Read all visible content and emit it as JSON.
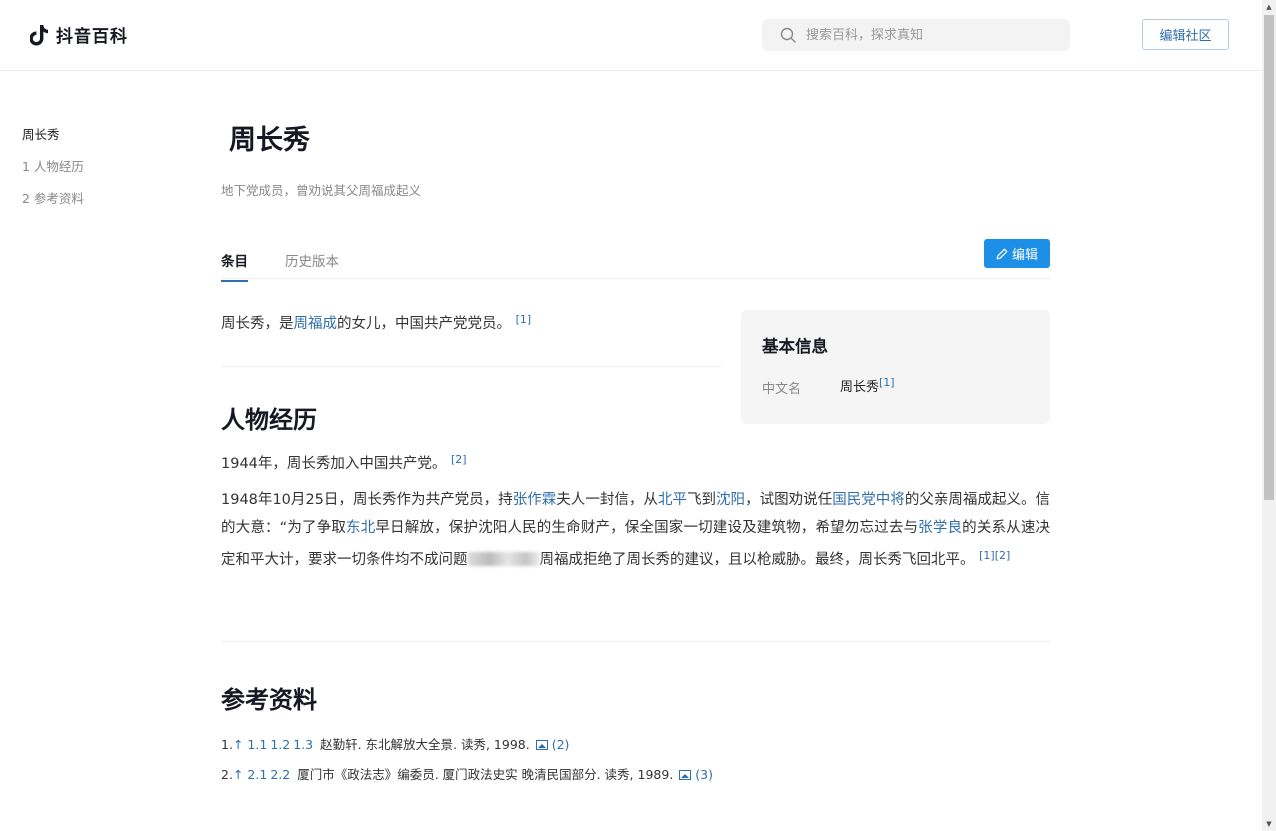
{
  "header": {
    "logo_text": "抖音百科",
    "search_placeholder": "搜索百科，探求真知",
    "community_button": "编辑社区"
  },
  "toc": {
    "items": [
      "周长秀",
      "1 人物经历",
      "2 参考资料"
    ]
  },
  "article": {
    "title": "周长秀",
    "subtitle": "地下党成员，曾劝说其父周福成起义",
    "tabs": [
      "条目",
      "历史版本"
    ],
    "edit_button": "编辑",
    "intro": {
      "pre": "周长秀，是",
      "link": "周福成",
      "post": "的女儿，中国共产党党员。",
      "ref": "[1]"
    },
    "sections": [
      {
        "heading": "人物经历",
        "para1": {
          "text": "1944年，周长秀加入中国共产党。",
          "ref": "[2]"
        },
        "para2": {
          "t1": "1948年10月25日，周长秀作为共产党员，持",
          "l1": "张作霖",
          "t2": "夫人一封信，从",
          "l2": "北平",
          "t3": "飞到",
          "l3": "沈阳",
          "t4": "，试图劝说任",
          "l4": "国民党中将",
          "t5": "的父亲周福成起义。信的大意：“为了争取",
          "l5": "东北",
          "t6": "早日解放，保护沈阳人民的生命财产，保全国家一切建设及建筑物，希望勿忘过去与",
          "l6": "张学良",
          "t7": "的关系从速决定和平大计，要求一切条件均不成问题",
          "t8": "周福成拒绝了周长秀的建议，且以枪威胁。最终，周长秀飞回北平。",
          "ref": "[1][2]"
        }
      },
      {
        "heading": "参考资料",
        "refs": [
          {
            "num": "1.",
            "arrow": "↑",
            "links": [
              "1.1",
              "1.2",
              "1.3"
            ],
            "text": "赵勤轩. 东北解放大全景. 读秀, 1998.",
            "count": "(2)"
          },
          {
            "num": "2.",
            "arrow": "↑",
            "links": [
              "2.1",
              "2.2"
            ],
            "text": "厦门市《政法志》编委员. 厦门政法史实 晚清民国部分. 读秀, 1989.",
            "count": "(3)"
          }
        ]
      }
    ]
  },
  "infobox": {
    "title": "基本信息",
    "key": "中文名",
    "value": "周长秀",
    "ref": "[1]"
  },
  "colors": {
    "link": "#2f6fad",
    "edit_button_bg": "#1e8fe6"
  }
}
